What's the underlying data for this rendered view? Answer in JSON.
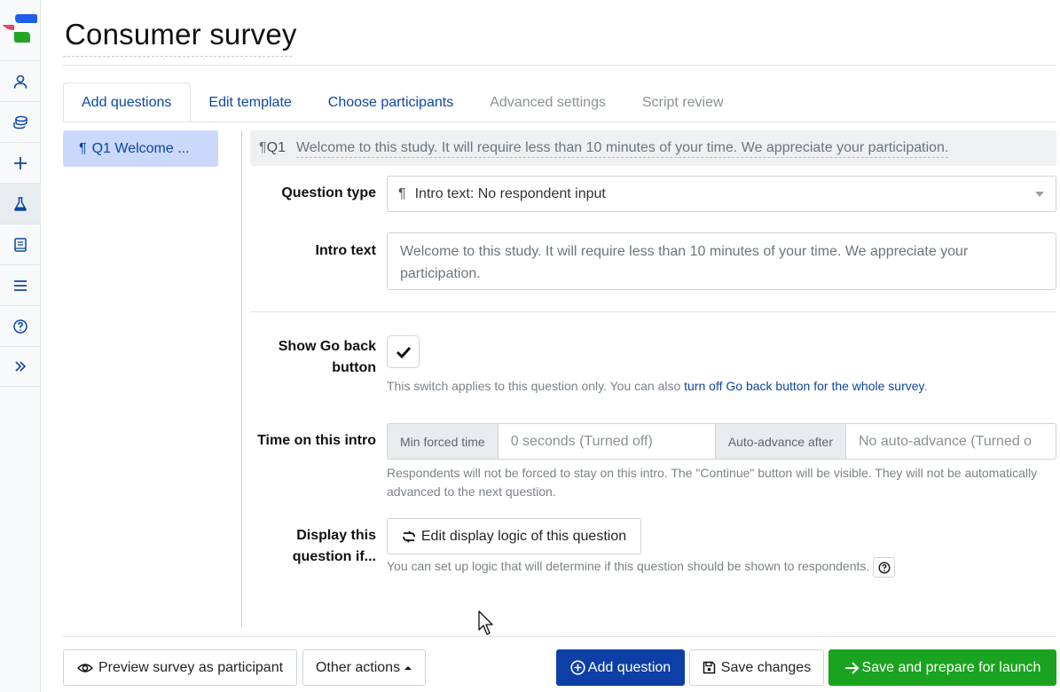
{
  "title": "Consumer survey",
  "sidebar": {
    "items": [
      {
        "icon": "user-icon"
      },
      {
        "icon": "coins-icon"
      },
      {
        "icon": "plus-icon"
      },
      {
        "icon": "flask-icon",
        "active": true
      },
      {
        "icon": "book-icon"
      },
      {
        "icon": "list-icon"
      },
      {
        "icon": "question-circle-icon"
      },
      {
        "icon": "chevrons-right-icon"
      }
    ]
  },
  "tabs": [
    {
      "label": "Add questions",
      "state": "active"
    },
    {
      "label": "Edit template",
      "state": "enabled"
    },
    {
      "label": "Choose participants",
      "state": "enabled"
    },
    {
      "label": "Advanced settings",
      "state": "disabled"
    },
    {
      "label": "Script review",
      "state": "disabled"
    }
  ],
  "question_list": [
    {
      "marker": "¶",
      "label": "Q1  Welcome ..."
    }
  ],
  "question": {
    "marker": "¶",
    "number": "Q1",
    "header_text": "Welcome to this study. It will require less than 10 minutes of your time. We appreciate your participation.",
    "type_label": "Question type",
    "type_value": "Intro text: No respondent input",
    "intro_label": "Intro text",
    "intro_value": "Welcome to this study. It will require less than 10 minutes of your time. We appreciate your participation.",
    "go_back_label_1": "Show Go back",
    "go_back_label_2": "button",
    "go_back_checked": true,
    "go_back_help": "This switch applies to this question only. You can also ",
    "go_back_link": "turn off Go back button for the whole survey",
    "go_back_help_end": ".",
    "time_label": "Time on this intro",
    "min_forced_label": "Min forced time",
    "min_forced_placeholder": "0 seconds (Turned off)",
    "auto_advance_label": "Auto-advance after",
    "auto_advance_placeholder": "No auto-advance (Turned o",
    "time_help": "Respondents will not be forced to stay on this intro. The \"Continue\" button will be visible. They will not be automatically advanced to the next question.",
    "display_label_1": "Display this",
    "display_label_2": "question if...",
    "display_button": "Edit display logic of this question",
    "display_help": "You can set up logic that will determine if this question should be shown to respondents."
  },
  "footer": {
    "preview": "Preview survey as participant",
    "other_actions": "Other actions",
    "add_question": "Add question",
    "save_changes": "Save changes",
    "save_launch": "Save and prepare for launch"
  },
  "colors": {
    "brand": "#0d47a1",
    "primary_button": "#0d3fa6",
    "success_button": "#1aa31f",
    "selected_item_bg": "#c9d8fb"
  }
}
